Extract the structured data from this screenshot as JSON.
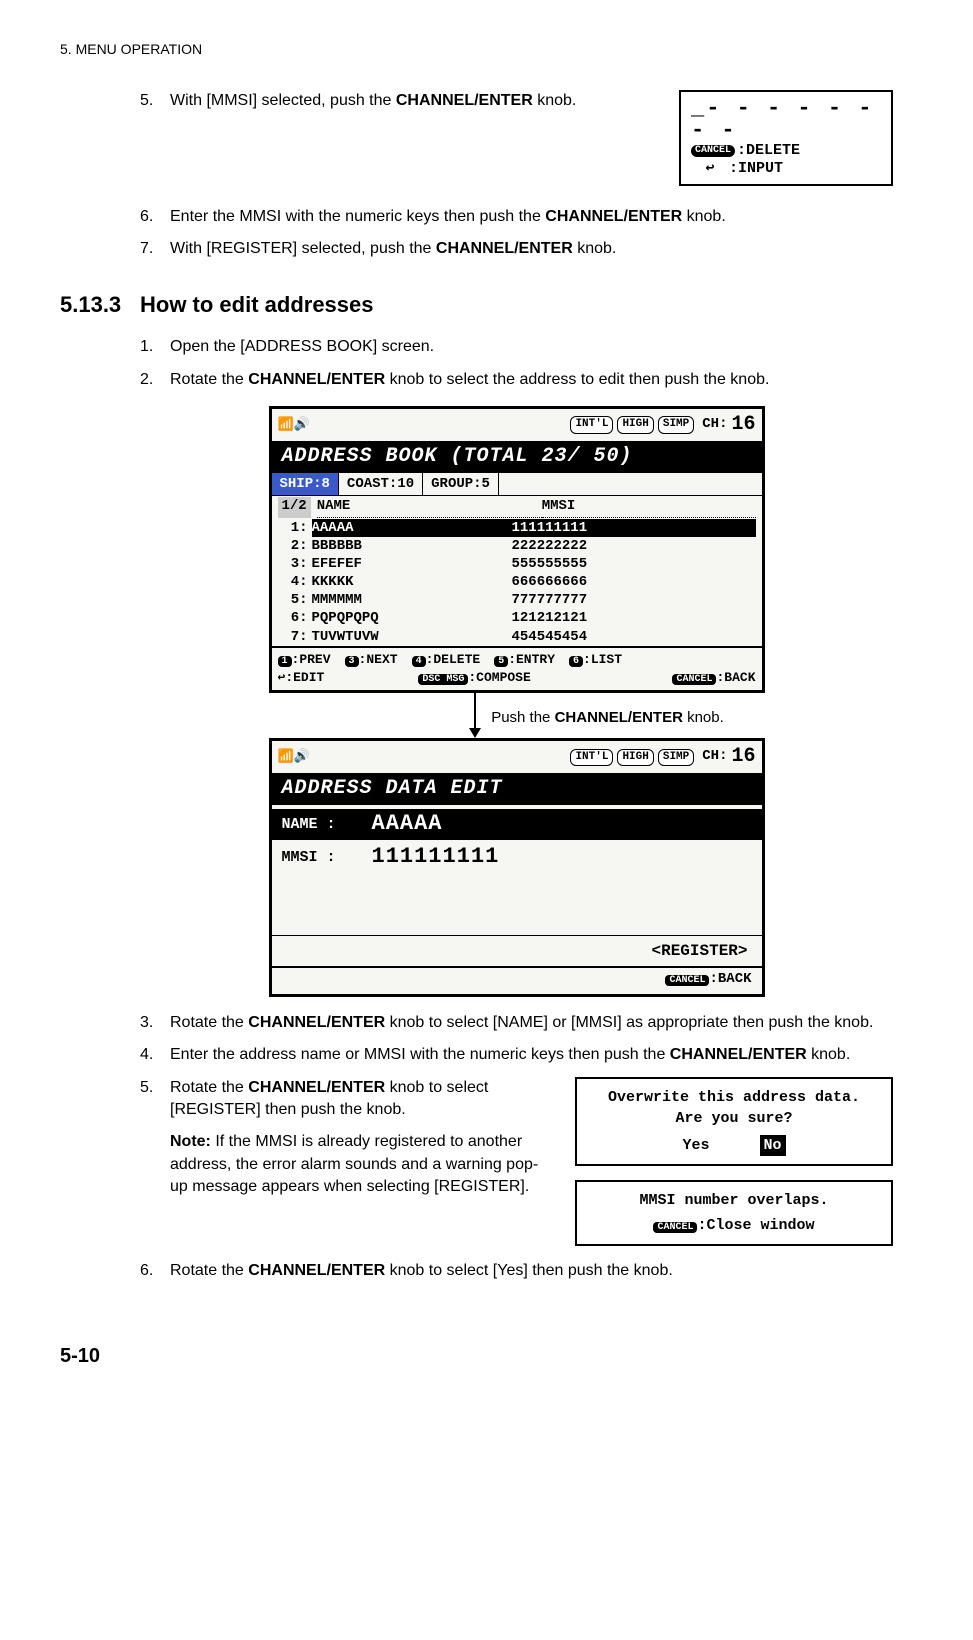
{
  "header": "5.  MENU OPERATION",
  "steps_a": {
    "s5": {
      "num": "5.",
      "text_pre": "With [MMSI] selected, push the ",
      "bold": "CHANNEL/ENTER",
      "text_post": " knob."
    },
    "s6": {
      "num": "6.",
      "text_pre": "Enter the MMSI with the numeric keys then push the ",
      "bold": "CHANNEL/ENTER",
      "text_post": " knob."
    },
    "s7": {
      "num": "7.",
      "text_pre": "With [REGISTER] selected, push the ",
      "bold": "CHANNEL/ENTER",
      "text_post": " knob."
    }
  },
  "mmsi_box": {
    "row1": "_- - - - - - - -",
    "cancel": "CANCEL",
    "cancel_lbl": ":DELETE",
    "enter": "↩",
    "enter_lbl": ":INPUT"
  },
  "section": {
    "num": "5.13.3",
    "title": "How to edit addresses"
  },
  "steps_b": {
    "s1": {
      "num": "1.",
      "text": "Open the [ADDRESS BOOK] screen."
    },
    "s2": {
      "num": "2.",
      "text_pre": "Rotate the ",
      "bold": "CHANNEL/ENTER",
      "text_post": " knob to select the address to edit then push the knob."
    },
    "s3": {
      "num": "3.",
      "text_pre": "Rotate the ",
      "bold": "CHANNEL/ENTER",
      "text_post": " knob to select [NAME] or [MMSI] as appropriate then push the knob."
    },
    "s4": {
      "num": "4.",
      "text_pre": "Enter the address name or MMSI with the numeric keys then push the ",
      "bold": "CHANNEL/ENTER",
      "text_post": " knob."
    },
    "s5": {
      "num": "5.",
      "text_pre": "Rotate the ",
      "bold": "CHANNEL/ENTER",
      "text_post": " knob to select [REGISTER] then push the knob."
    },
    "note_lbl": "Note:",
    "note_text": " If the MMSI is already registered to another address, the error alarm sounds and a warning pop-up message appears when selecting [REGISTER].",
    "s6": {
      "num": "6.",
      "text_pre": "Rotate the ",
      "bold": "CHANNEL/ENTER",
      "text_post": " knob to select [Yes] then push the knob."
    }
  },
  "arrow_caption_pre": "Push the ",
  "arrow_caption_bold": "CHANNEL/ENTER",
  "arrow_caption_post": " knob.",
  "screen1": {
    "tags": [
      "INT'L",
      "HIGH",
      "SIMP"
    ],
    "ch_lbl": "CH:",
    "ch": "16",
    "title": "ADDRESS BOOK   (TOTAL  23/ 50)",
    "tabs": {
      "ship": "SHIP:8",
      "coast": "COAST:10",
      "group": "GROUP:5"
    },
    "page": "1/2",
    "cols": {
      "name": "NAME",
      "mmsi": "MMSI"
    },
    "rows": [
      {
        "idx": "1:",
        "name": "AAAAA",
        "mmsi": "111111111",
        "sel": true
      },
      {
        "idx": "2:",
        "name": "BBBBBB",
        "mmsi": "222222222"
      },
      {
        "idx": "3:",
        "name": "EFEFEF",
        "mmsi": "555555555"
      },
      {
        "idx": "4:",
        "name": "KKKKK",
        "mmsi": "666666666"
      },
      {
        "idx": "5:",
        "name": "MMMMMM",
        "mmsi": "777777777"
      },
      {
        "idx": "6:",
        "name": "PQPQPQPQ",
        "mmsi": "121212121"
      },
      {
        "idx": "7:",
        "name": "TUVWTUVW",
        "mmsi": "454545454"
      }
    ],
    "hints1": {
      "k1": "1",
      "l1": ":PREV",
      "k3": "3",
      "l3": ":NEXT",
      "k4": "4",
      "l4": ":DELETE",
      "k5": "5",
      "l5": ":ENTRY",
      "k6": "6",
      "l6": ":LIST"
    },
    "hints2": {
      "enter": "↩",
      "l_enter": ":EDIT",
      "dsc": "DSC MSG",
      "l_dsc": ":COMPOSE",
      "cancel": "CANCEL",
      "l_cancel": ":BACK"
    }
  },
  "screen2": {
    "tags": [
      "INT'L",
      "HIGH",
      "SIMP"
    ],
    "ch_lbl": "CH:",
    "ch": "16",
    "title": "ADDRESS DATA EDIT",
    "name_lbl": "NAME :",
    "name_val": "AAAAA",
    "mmsi_lbl": "MMSI :",
    "mmsi_val": "111111111",
    "register": "<REGISTER>",
    "cancel": "CANCEL",
    "back": ":BACK"
  },
  "popup1": {
    "l1": "Overwrite this address data.",
    "l2": "Are you sure?",
    "yes": "Yes",
    "no": "No"
  },
  "popup2": {
    "l1": "MMSI number overlaps.",
    "cancel": "CANCEL",
    "l2": ":Close window"
  },
  "page_num": "5-10"
}
